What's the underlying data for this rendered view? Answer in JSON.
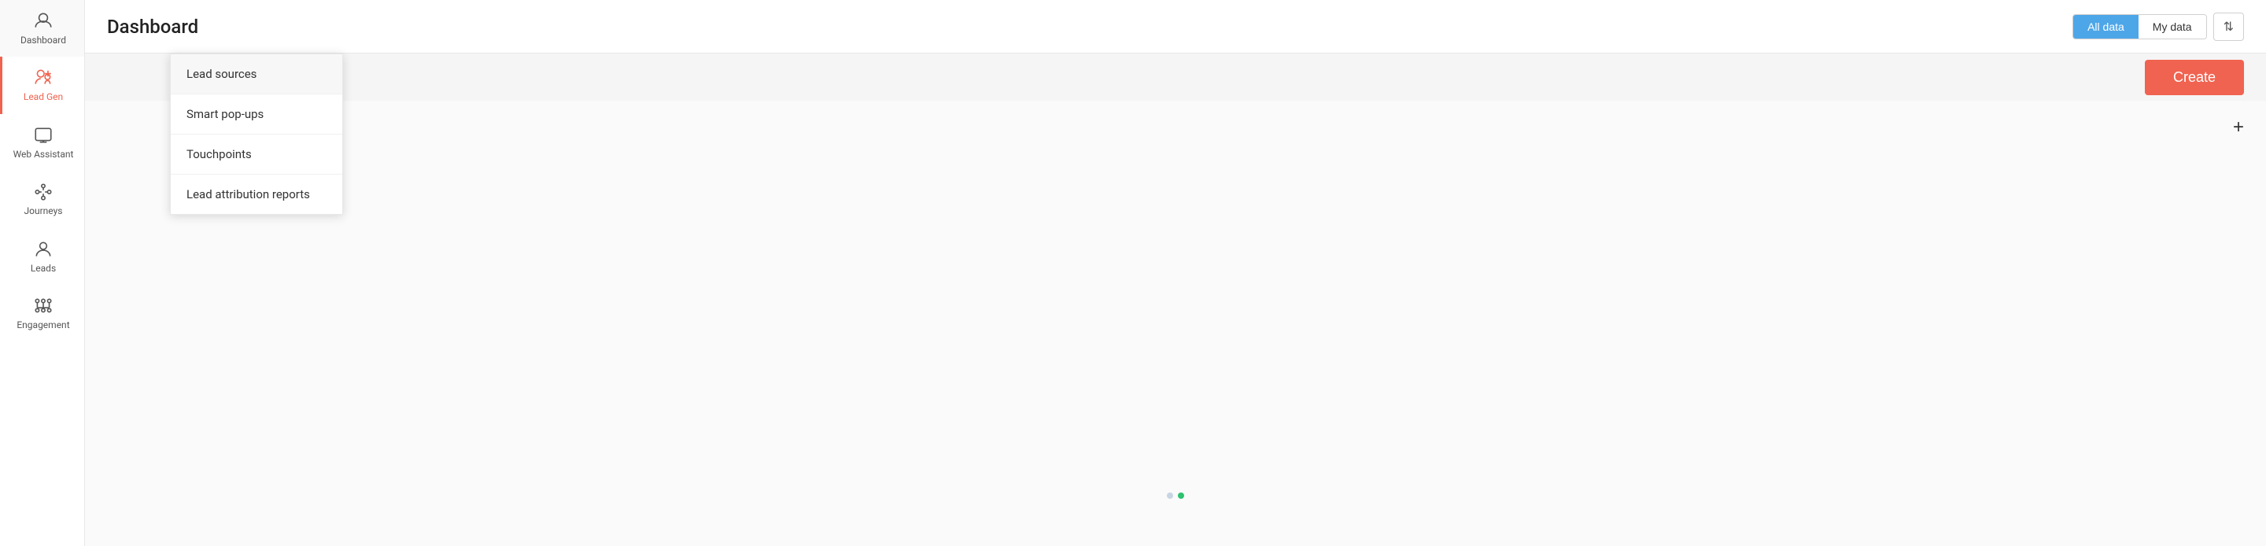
{
  "sidebar": {
    "items": [
      {
        "id": "dashboard",
        "label": "Dashboard",
        "active": false
      },
      {
        "id": "lead-gen",
        "label": "Lead Gen",
        "active": true
      },
      {
        "id": "web-assistant",
        "label": "Web Assistant",
        "active": false
      },
      {
        "id": "journeys",
        "label": "Journeys",
        "active": false
      },
      {
        "id": "leads",
        "label": "Leads",
        "active": false
      },
      {
        "id": "engagement",
        "label": "Engagement",
        "active": false
      }
    ]
  },
  "header": {
    "title": "Dashboard",
    "all_data_label": "All data",
    "my_data_label": "My data",
    "filter_icon": "⇅"
  },
  "subheader": {
    "create_label": "Create"
  },
  "content": {
    "plus_label": "+"
  },
  "dropdown": {
    "items": [
      {
        "id": "lead-sources",
        "label": "Lead sources"
      },
      {
        "id": "smart-popups",
        "label": "Smart pop-ups"
      },
      {
        "id": "touchpoints",
        "label": "Touchpoints"
      },
      {
        "id": "lead-attribution",
        "label": "Lead attribution reports"
      }
    ]
  }
}
